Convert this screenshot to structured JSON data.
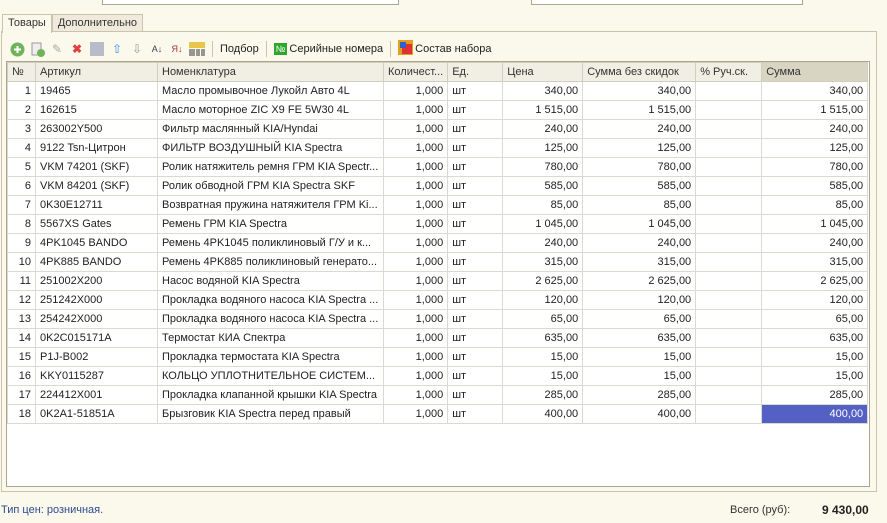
{
  "tabs": [
    "Товары",
    "Дополнительно"
  ],
  "toolbar": {
    "podbor": "Подбор",
    "serial": "Серийные номера",
    "serial_badge": "№",
    "kit": "Состав набора"
  },
  "columns": [
    "№",
    "Артикул",
    "Номенклатура",
    "Количест...",
    "Ед.",
    "Цена",
    "Сумма без скидок",
    "% Руч.ск.",
    "Сумма"
  ],
  "rows": [
    [
      "1",
      "19465",
      "Масло промывочное Лукойл Авто 4L",
      "1,000",
      "шт",
      "340,00",
      "340,00",
      "",
      "340,00"
    ],
    [
      "2",
      "162615",
      "Масло моторное ZIC X9 FE 5W30 4L",
      "1,000",
      "шт",
      "1 515,00",
      "1 515,00",
      "",
      "1 515,00"
    ],
    [
      "3",
      "263002Y500",
      "Фильтр маслянный KIA/Hyndai",
      "1,000",
      "шт",
      "240,00",
      "240,00",
      "",
      "240,00"
    ],
    [
      "4",
      "9122 Tsn-Цитрон",
      "ФИЛЬТР ВОЗДУШНЫЙ KIA Spectra",
      "1,000",
      "шт",
      "125,00",
      "125,00",
      "",
      "125,00"
    ],
    [
      "5",
      "VKM 74201 (SKF)",
      "Ролик натяжитель ремня ГРМ KIA Spectr...",
      "1,000",
      "шт",
      "780,00",
      "780,00",
      "",
      "780,00"
    ],
    [
      "6",
      "VKM 84201 (SKF)",
      "Ролик обводной  ГРМ KIA Spectra SKF",
      "1,000",
      "шт",
      "585,00",
      "585,00",
      "",
      "585,00"
    ],
    [
      "7",
      "0K30E12711",
      "Возвратная пружина натяжителя ГРМ Ki...",
      "1,000",
      "шт",
      "85,00",
      "85,00",
      "",
      "85,00"
    ],
    [
      "8",
      "5567XS  Gates",
      "Ремень ГРМ KIA Spectra",
      "1,000",
      "шт",
      "1 045,00",
      "1 045,00",
      "",
      "1 045,00"
    ],
    [
      "9",
      "4PK1045 BANDO",
      "Ремень 4PK1045 поликлиновый Г/У и к...",
      "1,000",
      "шт",
      "240,00",
      "240,00",
      "",
      "240,00"
    ],
    [
      "10",
      "4PK885 BANDO",
      "Ремень 4PK885 поликлиновый генерато...",
      "1,000",
      "шт",
      "315,00",
      "315,00",
      "",
      "315,00"
    ],
    [
      "11",
      "251002X200",
      "Насос водяной KIA Spectra",
      "1,000",
      "шт",
      "2 625,00",
      "2 625,00",
      "",
      "2 625,00"
    ],
    [
      "12",
      "251242X000",
      "Прокладка водяного насоса KIA Spectra ...",
      "1,000",
      "шт",
      "120,00",
      "120,00",
      "",
      "120,00"
    ],
    [
      "13",
      "254242X000",
      "Прокладка водяного насоса KIA Spectra ...",
      "1,000",
      "шт",
      "65,00",
      "65,00",
      "",
      "65,00"
    ],
    [
      "14",
      "0K2C015171A",
      "Термостат КИА Спектра",
      "1,000",
      "шт",
      "635,00",
      "635,00",
      "",
      "635,00"
    ],
    [
      "15",
      "P1J-B002",
      "Прокладка термостата KIA Spectra",
      "1,000",
      "шт",
      "15,00",
      "15,00",
      "",
      "15,00"
    ],
    [
      "16",
      "KKY0115287",
      "КОЛЬЦО УПЛОТНИТЕЛЬНОЕ СИСТЕМ...",
      "1,000",
      "шт",
      "15,00",
      "15,00",
      "",
      "15,00"
    ],
    [
      "17",
      "224412X001",
      "Прокладка клапанной крышки KIA Spectra",
      "1,000",
      "шт",
      "285,00",
      "285,00",
      "",
      "285,00"
    ],
    [
      "18",
      "0K2A1-51851A",
      "Брызговик KIA Spectra перед правый",
      "1,000",
      "шт",
      "400,00",
      "400,00",
      "",
      "400,00"
    ]
  ],
  "footer": {
    "price_type": "Тип цен: розничная.",
    "total_label": "Всего (руб):",
    "total": "9 430,00"
  }
}
